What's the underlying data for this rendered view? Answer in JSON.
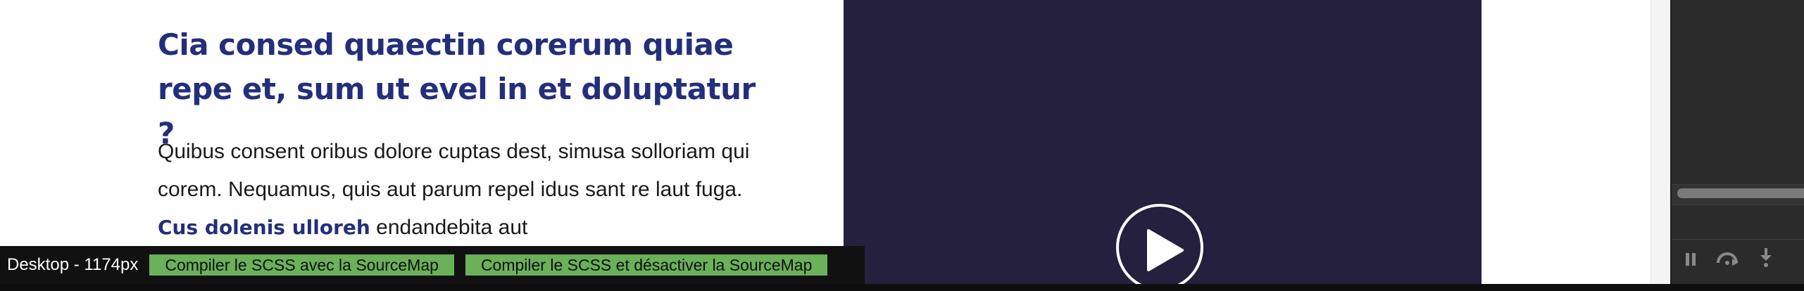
{
  "article": {
    "heading": "Cia consed quaectin corerum quiae repe et, sum ut evel in et doluptatur ?",
    "paragraph_intro": "Quibus consent oribus dolore cuptas dest, simusa solloriam qui corem. Nequamus, quis aut parum repel idus sant re laut fuga. ",
    "paragraph_highlight": "Cus dolenis ulloreh",
    "paragraph_rest": " endandebita aut"
  },
  "video": {
    "play_icon": "play-circle-icon"
  },
  "debug_bar": {
    "viewport_label": "Desktop - 1174px",
    "compile_with_sourcemap": "Compiler le SCSS avec la SourceMap",
    "compile_without_sourcemap": "Compiler le SCSS et désactiver la SourceMap"
  },
  "devtools": {
    "icons": [
      "pause-icon",
      "step-over-icon",
      "step-into-icon"
    ]
  },
  "colors": {
    "heading": "#232f7a",
    "video_bg": "#24203e",
    "button_green": "#6ab15a",
    "debug_bar_bg": "#111111",
    "devtools_bg": "#2b2b2b"
  }
}
